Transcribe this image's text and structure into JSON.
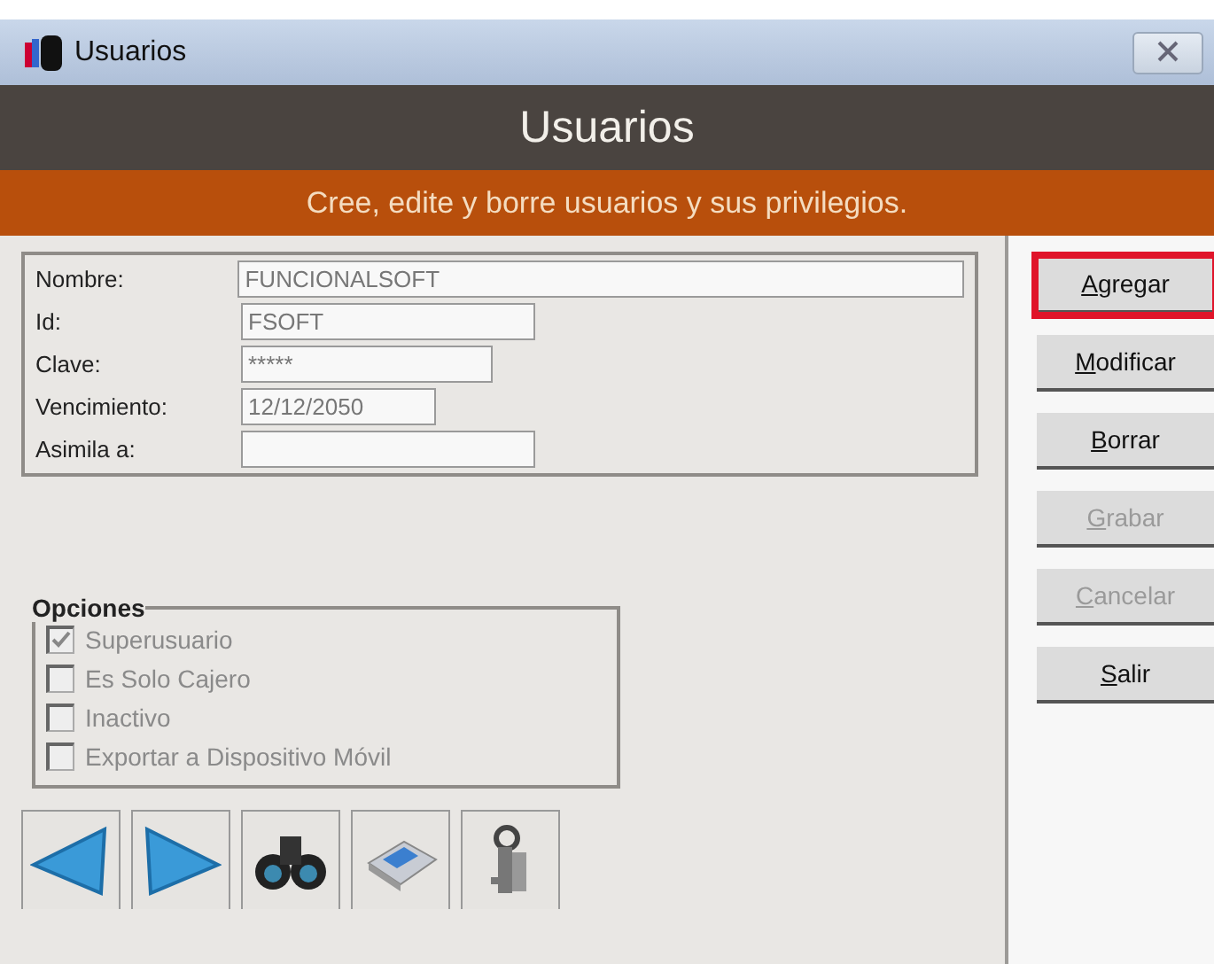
{
  "window": {
    "title": "Usuarios"
  },
  "header": {
    "title": "Usuarios",
    "subtitle": "Cree, edite y borre usuarios y sus privilegios."
  },
  "fields": [
    {
      "label": "Nombre:",
      "value": "FUNCIONALSOFT",
      "kind": "wide"
    },
    {
      "label": "Id:",
      "value": "FSOFT",
      "kind": "medium"
    },
    {
      "label": "Clave:",
      "value": "*****",
      "kind": "password"
    },
    {
      "label": "Vencimiento:",
      "value": "12/12/2050",
      "kind": "short"
    },
    {
      "label": "Asimila a:",
      "kind": "medium"
    }
  ],
  "options": {
    "title": "Opciones",
    "items": [
      {
        "label": "Superusuario",
        "checked": true,
        "disabled": true
      },
      {
        "label": "Es Solo Cajero",
        "checked": false,
        "disabled": true
      },
      {
        "label": "Inactivo",
        "checked": false,
        "disabled": true
      },
      {
        "label": "Exportar a Dispositivo Móvil",
        "checked": false,
        "disabled": true
      }
    ]
  },
  "buttons": [
    {
      "label": "Agregar",
      "highlighted": true,
      "disabled": false
    },
    {
      "label": "Modificar",
      "highlighted": false,
      "disabled": false
    },
    {
      "label": "Borrar",
      "highlighted": false,
      "disabled": false
    },
    {
      "label": "Grabar",
      "highlighted": false,
      "disabled": true
    },
    {
      "label": "Cancelar",
      "highlighted": false,
      "disabled": true
    },
    {
      "label": "Salir",
      "highlighted": false,
      "disabled": false
    }
  ],
  "toolbar": [
    {
      "kind": "prev"
    },
    {
      "kind": "next"
    },
    {
      "kind": "search"
    },
    {
      "kind": "print"
    },
    {
      "kind": "keys"
    }
  ]
}
